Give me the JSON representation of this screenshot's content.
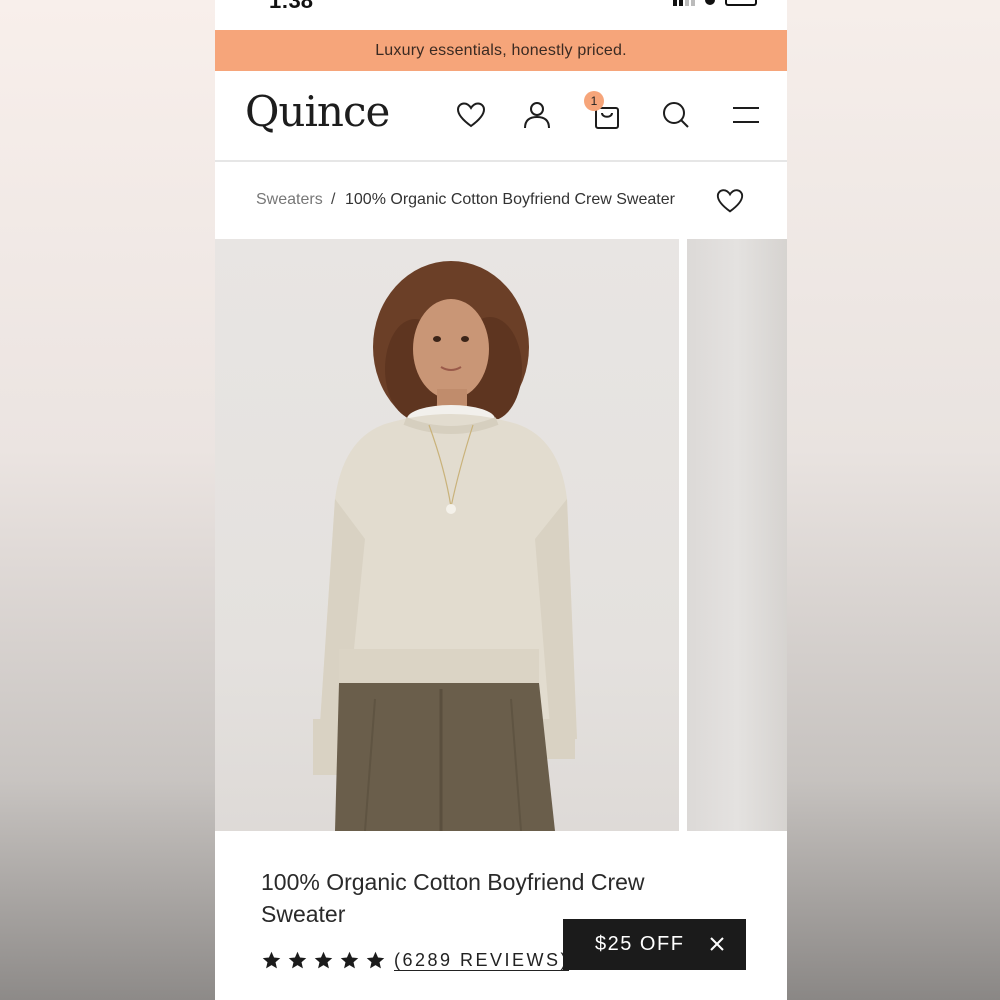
{
  "status_bar": {
    "time": "1:38"
  },
  "promo_banner": {
    "text": "Luxury essentials, honestly priced."
  },
  "header": {
    "logo": "Quince",
    "cart_count": "1",
    "icons": [
      "heart-icon",
      "account-icon",
      "cart-icon",
      "search-icon",
      "menu-icon"
    ]
  },
  "breadcrumb": {
    "parent": "Sweaters",
    "separator": "/",
    "current": "100% Organic Cotton Boyfriend Crew Sweater"
  },
  "product": {
    "title": "100% Organic Cotton Boyfriend Crew Sweater",
    "rating_stars": 5,
    "reviews_label": "(6289 REVIEWS)"
  },
  "offer": {
    "label": "$25 OFF"
  },
  "colors": {
    "promo": "#f6a57a",
    "offer_bg": "#1b1b1b",
    "text": "#2a2a2a",
    "sweater": "#e2dccf",
    "trousers": "#6a5e4b"
  }
}
